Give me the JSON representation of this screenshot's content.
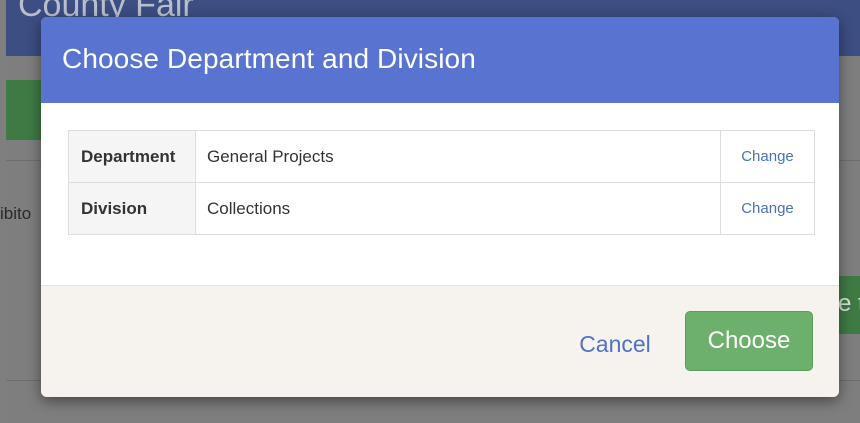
{
  "background": {
    "header_title": "County Fair",
    "side_text": "ibito",
    "side_button_text": "e t"
  },
  "modal": {
    "title": "Choose Department and Division",
    "rows": [
      {
        "label": "Department",
        "value": "General Projects",
        "action": "Change"
      },
      {
        "label": "Division",
        "value": "Collections",
        "action": "Change"
      }
    ],
    "cancel_label": "Cancel",
    "choose_label": "Choose"
  },
  "colors": {
    "header": "#5874d0",
    "choose_button": "#6cb06b",
    "link": "#4a72b8",
    "footer": "#f6f3ef"
  }
}
